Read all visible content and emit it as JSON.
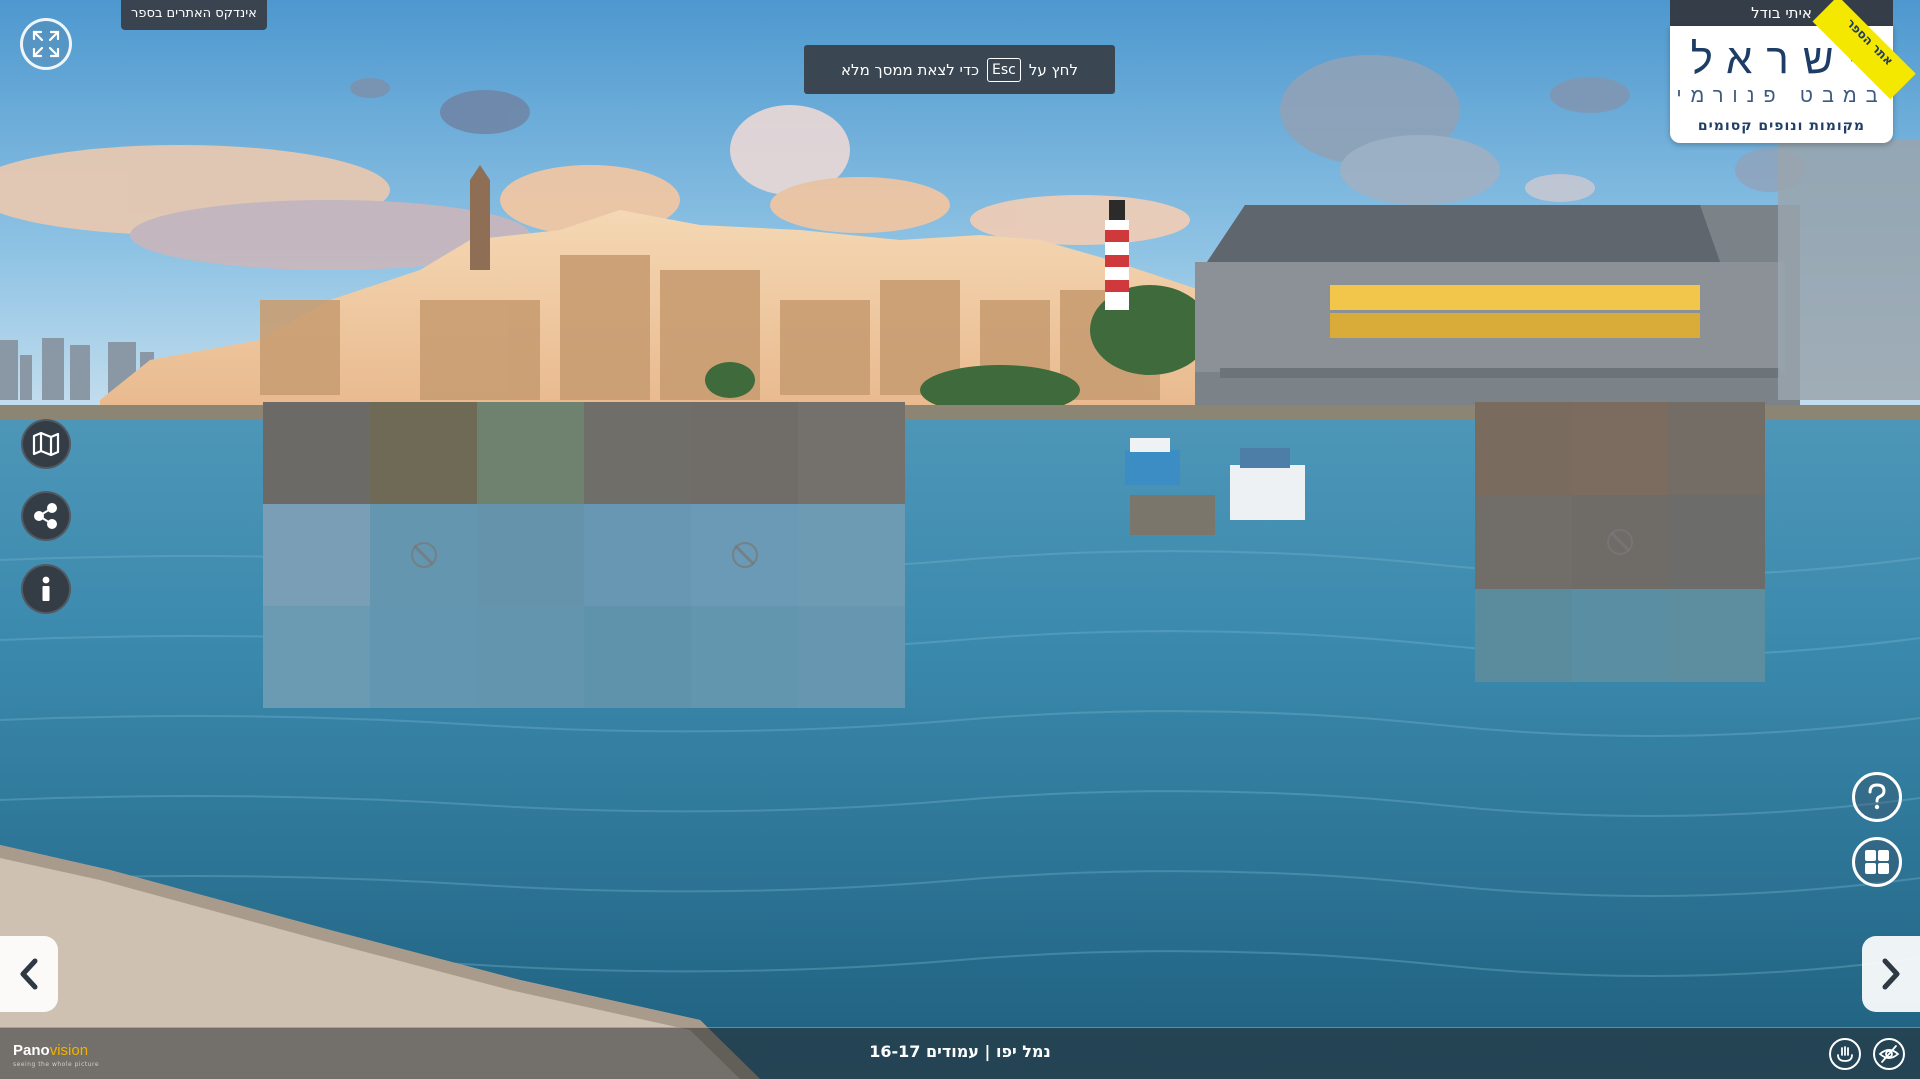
{
  "index_button_label": "אינדקס האתרים בספר",
  "esc_notice": {
    "before": "לחץ על",
    "key": "Esc",
    "after": "כדי לצאת ממסך מלא"
  },
  "logo": {
    "author": "איתי בודל",
    "title": "ישראל",
    "subtitle": "במבט פנורמי",
    "tagline": "מקומות ונופים קסומים",
    "ribbon": "אתר הספר"
  },
  "left_controls": [
    "expand-icon",
    "map-icon",
    "share-icon",
    "info-icon"
  ],
  "right_controls": [
    "help-icon",
    "grid-icon"
  ],
  "nav": {
    "prev": "chevron-left-icon",
    "next": "chevron-right-icon"
  },
  "bottom_bar": {
    "brand_main": "Pano",
    "brand_accent": "vision",
    "brand_tagline": "seeing the whole picture",
    "caption": "נמל יפו | עמודים 16-17"
  },
  "colors": {
    "dark_panel": "#343c46",
    "accent_yellow": "#f4e700",
    "brand_orange": "#f0b400",
    "logo_blue": "#1d3c66"
  }
}
